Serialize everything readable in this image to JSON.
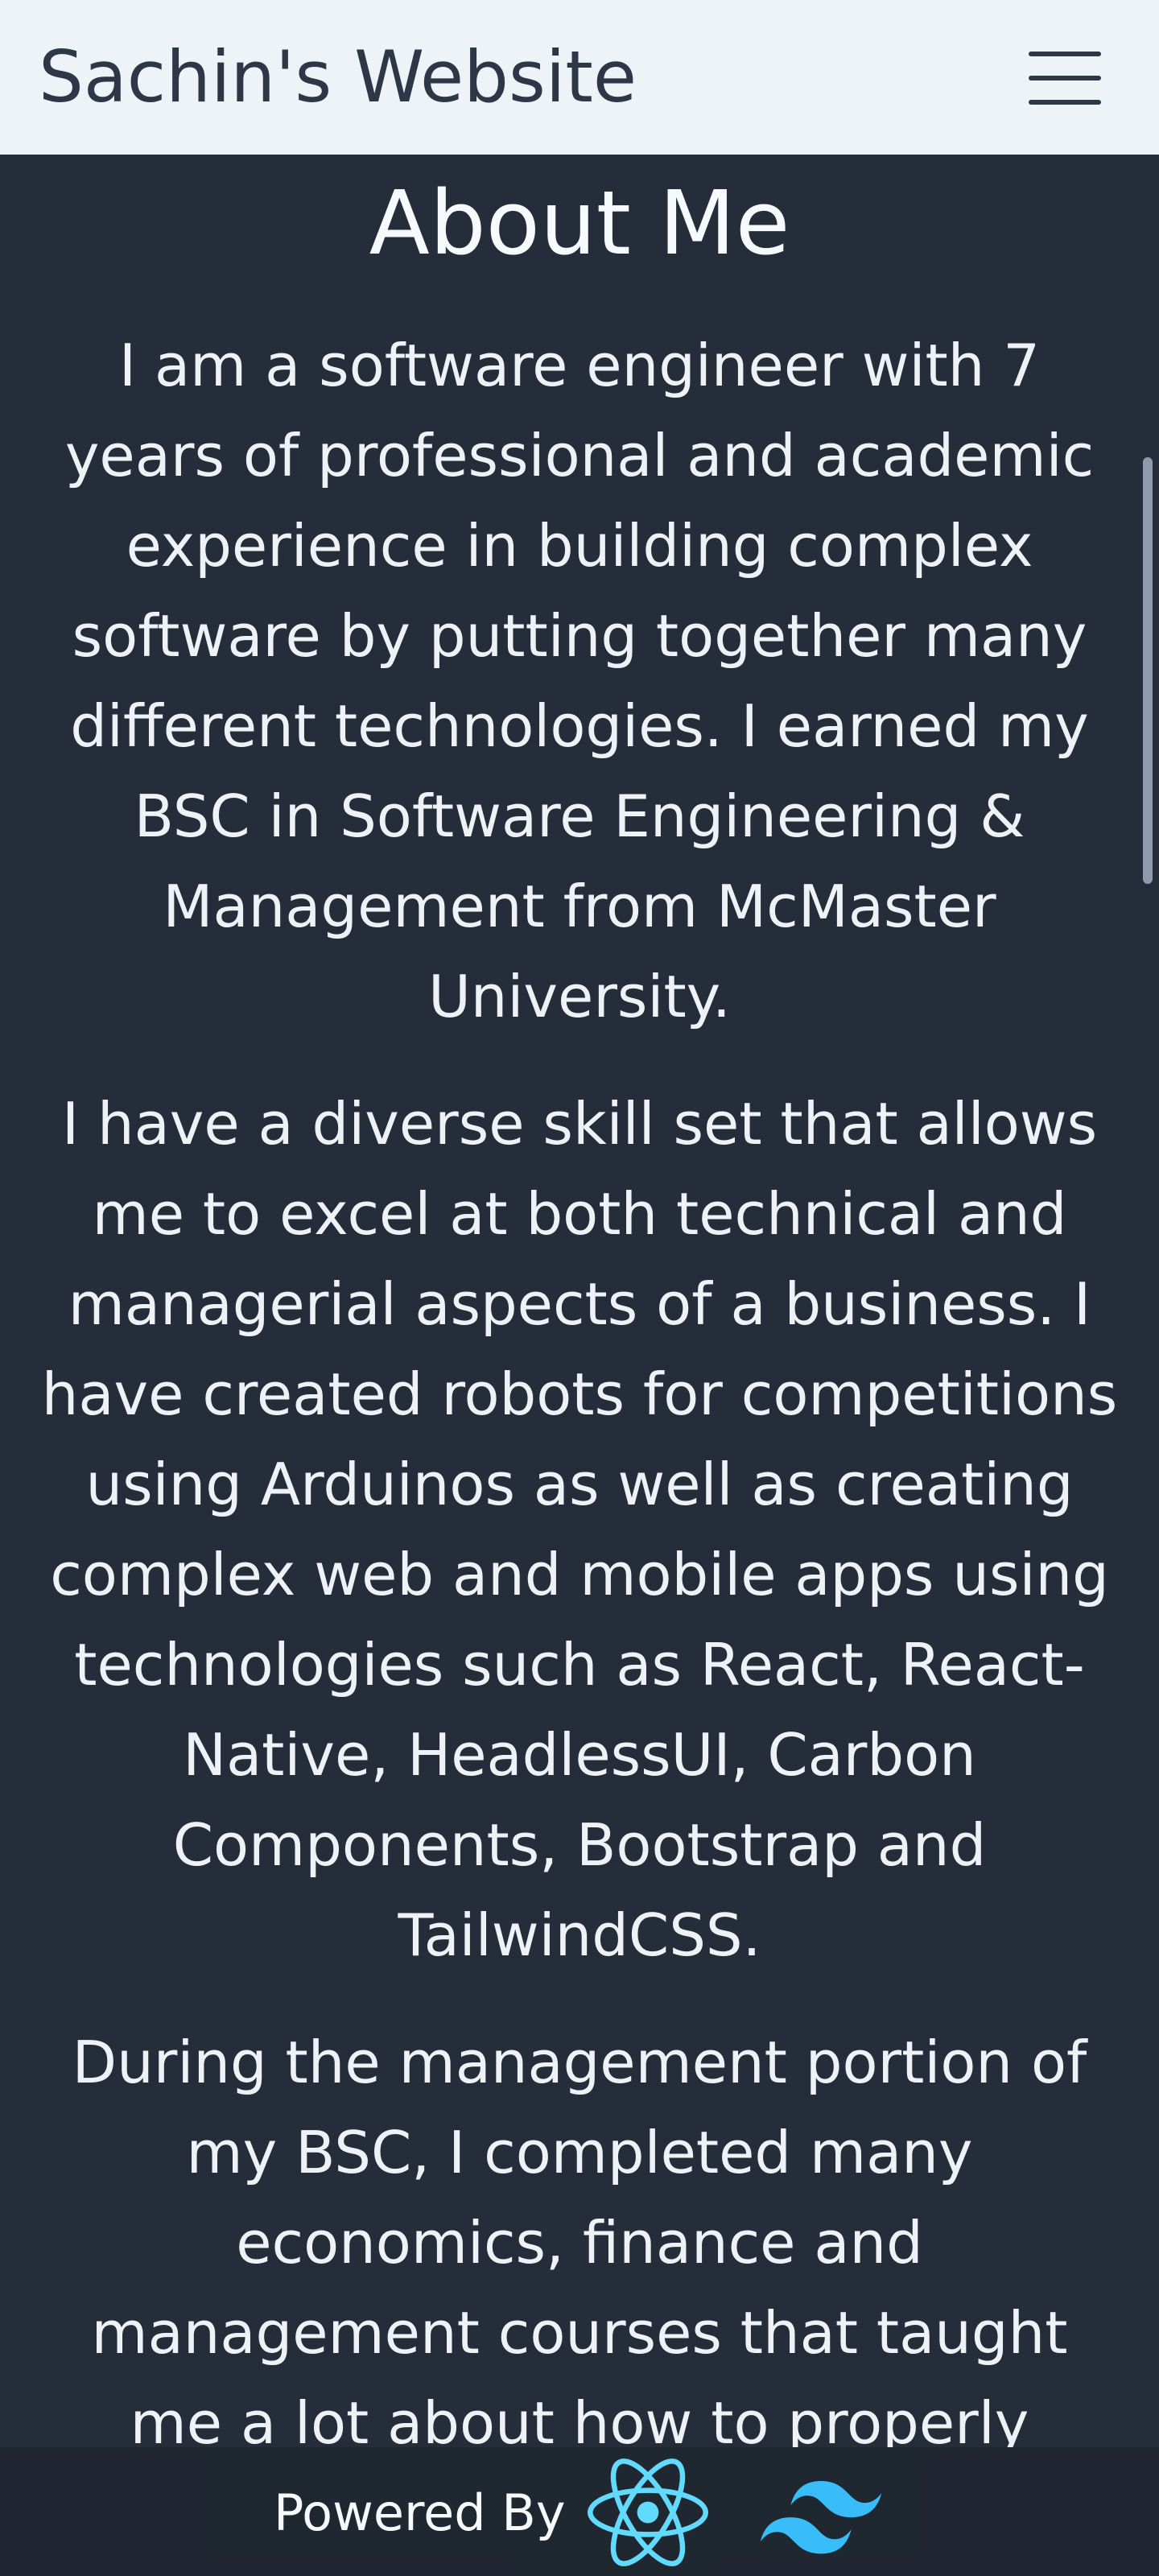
{
  "header": {
    "site_title": "Sachin's Website",
    "menu_icon": "hamburger-menu-icon"
  },
  "main": {
    "title": "About Me",
    "paragraphs": [
      "I am a software engineer with 7 years of professional and academic experience in building complex software by putting together many different technologies. I earned my BSC in Software Engineering & Management from McMaster University.",
      "I have a diverse skill set that allows me to excel at both technical and managerial aspects of a business. I have created robots for competitions using Arduinos as well as creating complex web and mobile apps using technologies such as React, React-Native, HeadlessUI, Carbon Components, Bootstrap and TailwindCSS.",
      "During the management portion of my BSC, I completed many economics, finance and management courses that taught me a lot about how to properly manage a business."
    ]
  },
  "footer": {
    "powered_by": "Powered By",
    "icons": [
      "react-logo-icon",
      "tailwind-logo-icon"
    ]
  },
  "colors": {
    "header_bg": "#eef3f8",
    "body_bg": "#252d3a",
    "text": "#edf2f7",
    "react": "#61dafb",
    "tailwind": "#38bdf8"
  }
}
